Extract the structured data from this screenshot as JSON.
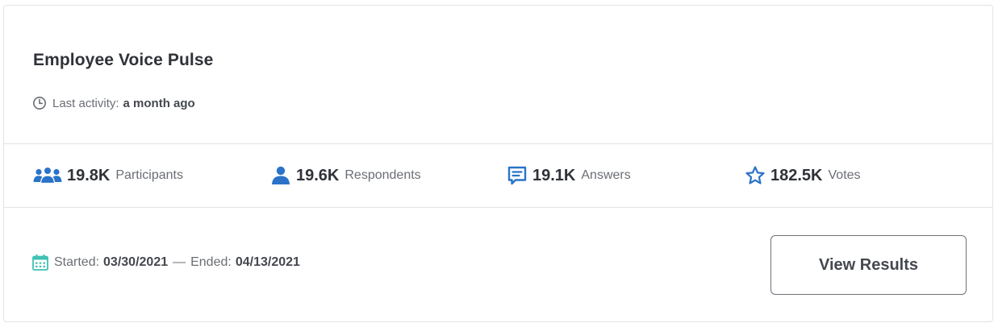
{
  "survey": {
    "title": "Employee Voice Pulse",
    "activity_label": "Last activity:",
    "activity_value": "a month ago"
  },
  "stats": [
    {
      "icon": "participants-icon",
      "value": "19.8K",
      "label": "Participants"
    },
    {
      "icon": "respondent-icon",
      "value": "19.6K",
      "label": "Respondents"
    },
    {
      "icon": "answers-icon",
      "value": "19.1K",
      "label": "Answers"
    },
    {
      "icon": "star-icon",
      "value": "182.5K",
      "label": "Votes"
    }
  ],
  "dates": {
    "started_label": "Started:",
    "started_value": "03/30/2021",
    "separator": "—",
    "ended_label": "Ended:",
    "ended_value": "04/13/2021"
  },
  "actions": {
    "view_results_label": "View Results"
  },
  "colors": {
    "accent_blue": "#2a73c9",
    "calendar_teal": "#3fc1b3",
    "title_text": "#2f3237",
    "muted_text": "#6a6e74",
    "border": "#e1e3e6"
  }
}
